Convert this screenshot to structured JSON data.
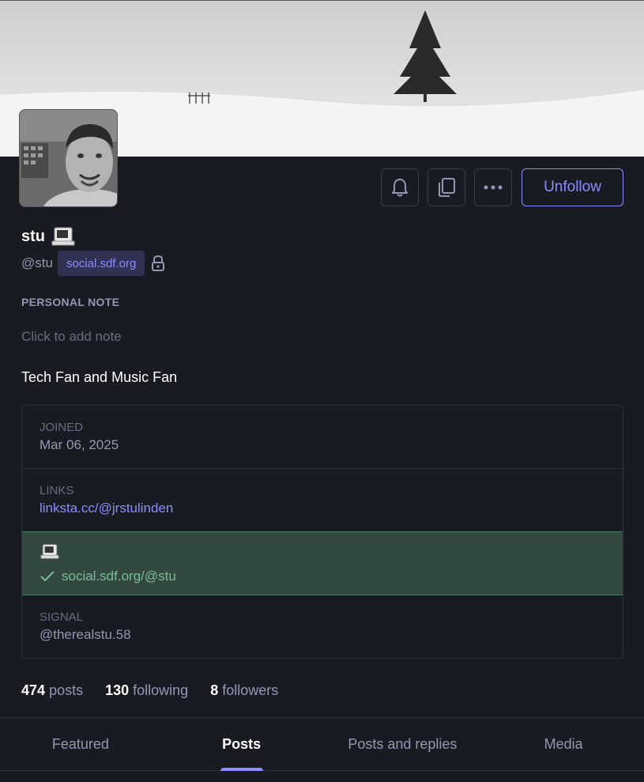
{
  "profile": {
    "display_name": "stu",
    "emoji_icon": "computer-emoji-icon",
    "acct": "@stu",
    "domain": "social.sdf.org",
    "locked": true,
    "bio": "Tech Fan and Music Fan"
  },
  "actions": {
    "notify_icon": "bell-icon",
    "copy_icon": "copy-icon",
    "more_icon": "ellipsis-icon",
    "unfollow_label": "Unfollow"
  },
  "note": {
    "label": "PERSONAL NOTE",
    "placeholder": "Click to add note"
  },
  "fields": [
    {
      "name": "JOINED",
      "value": "Mar 06, 2025"
    },
    {
      "name": "LINKS",
      "value": "linksta.cc/@jrstulinden"
    },
    {
      "name_icon": "computer-emoji-icon",
      "value": "social.sdf.org/@stu",
      "verified": true
    },
    {
      "name": "SIGNAL",
      "value": "@therealstu.58"
    }
  ],
  "counts": [
    {
      "number": "474",
      "label": "posts"
    },
    {
      "number": "130",
      "label": "following"
    },
    {
      "number": "8",
      "label": "followers"
    }
  ],
  "tabs": [
    {
      "label": "Featured",
      "active": false
    },
    {
      "label": "Posts",
      "active": true
    },
    {
      "label": "Posts and replies",
      "active": false
    },
    {
      "label": "Media",
      "active": false
    }
  ],
  "colors": {
    "background": "#191b22",
    "accent": "#8c8dff",
    "verified_bg": "#33493f",
    "verified_text": "#79bd9a",
    "muted": "#9597b2"
  }
}
